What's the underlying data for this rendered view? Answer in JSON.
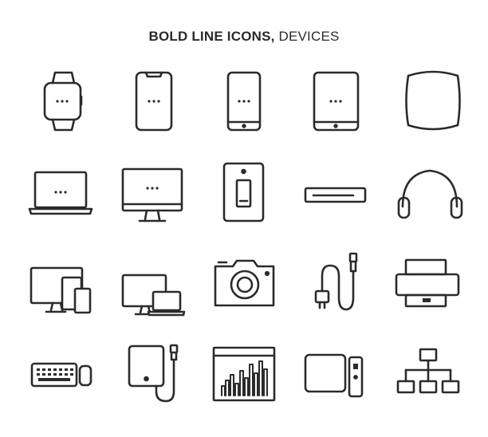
{
  "title": {
    "bold": "BOLD LINE ICONS,",
    "light": " DEVICES"
  },
  "colors": {
    "stroke": "#2b2b2b",
    "background": "#ffffff"
  },
  "icons": [
    "smartwatch-icon",
    "smartphone-notch-icon",
    "smartphone-icon",
    "tablet-icon",
    "smart-speaker-icon",
    "laptop-icon",
    "desktop-monitor-icon",
    "light-switch-icon",
    "set-top-box-icon",
    "headphones-icon",
    "multi-device-icon",
    "desktop-laptop-icon",
    "camera-icon",
    "charging-cable-icon",
    "printer-icon",
    "keyboard-mouse-icon",
    "external-drive-icon",
    "chart-window-icon",
    "smart-tv-box-remote-icon",
    "network-hierarchy-icon"
  ]
}
